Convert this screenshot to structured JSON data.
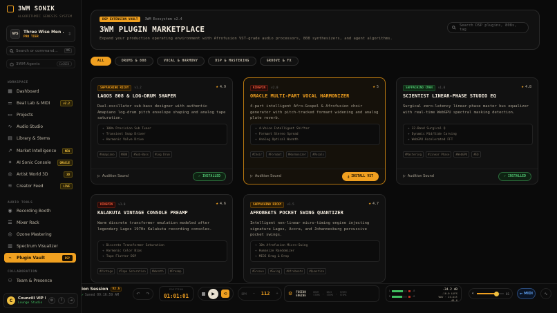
{
  "brand": {
    "title": "3WM SONIK",
    "subtitle": "ALGORITHMIC GENESIS SYSTEM"
  },
  "workspace": {
    "initials": "WS",
    "name": "Three Wise Men ...",
    "tier": "PRO TIER"
  },
  "search": {
    "placeholder": "Search or command...",
    "shortcut": "⌘K"
  },
  "agents": {
    "label": "3WM Agents",
    "state": "CLOSED"
  },
  "sections": {
    "workspace": "WORKSPACE",
    "audio_tools": "AUDIO TOOLS",
    "collaboration": "COLLABORATION"
  },
  "nav": [
    {
      "label": "Dashboard",
      "icon": "grid-icon"
    },
    {
      "label": "Beat Lab & MIDI",
      "icon": "sliders-icon",
      "badge": "v2.2"
    },
    {
      "label": "Projects",
      "icon": "folder-icon"
    },
    {
      "label": "Audio Studio",
      "icon": "waveform-icon"
    },
    {
      "label": "Library & Stems",
      "icon": "library-icon"
    },
    {
      "label": "Market Intelligence",
      "icon": "chart-icon",
      "badge": "NEW"
    },
    {
      "label": "AI Sonic Console",
      "icon": "sparkle-icon",
      "badge": "ORACLE"
    },
    {
      "label": "Artist World 3D",
      "icon": "globe-icon",
      "badge": "3D"
    },
    {
      "label": "Creator Feed",
      "icon": "feed-icon",
      "badge": "LIVE"
    }
  ],
  "audio_nav": [
    {
      "label": "Recording Booth",
      "icon": "mic-icon"
    },
    {
      "label": "Mixer Rack",
      "icon": "mixer-icon"
    },
    {
      "label": "Ozone Mastering",
      "icon": "target-icon"
    },
    {
      "label": "Spectrum Visualizer",
      "icon": "spectrum-icon"
    },
    {
      "label": "Plugin Vault",
      "icon": "plug-icon",
      "badge": "DSP"
    }
  ],
  "collab_nav": [
    {
      "label": "Team & Presence",
      "icon": "team-icon"
    }
  ],
  "user": {
    "initial": "C",
    "name": "Councill VIP P...",
    "status": "Lounge Studio"
  },
  "hero": {
    "kicker": "DSP EXTENSION VAULT",
    "ecosystem": "3WM Ecosystem v2.4",
    "title": "3WM PLUGIN MARKETPLACE",
    "desc": "Expand your production operating environment with Afrofusion VST-grade audio processors, 808 synthesizers, and agent algorithms.",
    "search_placeholder": "Search DSP plugins, 808s, tag"
  },
  "filters": [
    "ALL",
    "DRUMS & 808",
    "VOCAL & HARMONY",
    "DSP & MASTERING",
    "GROOVE & FX"
  ],
  "cards": [
    {
      "vendor": "SAPPACHINO RICKY",
      "vendor_color": "amber",
      "version": "v1.2",
      "rating": "4.9",
      "title": "LAGOS 808 & LOG-DRUM SHAPER",
      "desc": "Dual-oscillator sub-bass designer with authentic Amapiano log-drum pitch envelope shaping and analog tape saturation.",
      "features": [
        "100% Precision Sub Tuner",
        "Transient Snap Driver",
        "Harmonic Valve Drive"
      ],
      "tags": [
        "#Amapiano",
        "#808",
        "#Sub-Bass",
        "#Log Drum"
      ],
      "audition": "Audition Sound",
      "action": "INSTALLED",
      "action_type": "installed"
    },
    {
      "vendor": "KINGPIN",
      "vendor_color": "red",
      "version": "v2.0",
      "rating": "5",
      "title": "ORACLE MULTI-PART VOCAL HARMONIZER",
      "desc": "4-part intelligent Afro-Gospel & Afrofusion choir generator with pitch-tracked formant widening and analog plate reverb.",
      "features": [
        "4-Voice Intelligent Shifter",
        "Formant Stereo Spread",
        "Analog Optical Warmth"
      ],
      "tags": [
        "#Choir",
        "#Formant",
        "#Harmonizer",
        "#Vocals"
      ],
      "audition": "Audition Sound",
      "action": "INSTALL VST",
      "action_type": "install",
      "featured": true
    },
    {
      "vendor": "SAPPACHINO CMAN",
      "vendor_color": "green",
      "version": "v1.0",
      "rating": "4.8",
      "title": "SCIENTIST LINEAR-PHASE STUDIO EQ",
      "desc": "Surgical zero-latency linear-phase master bus equalizer with real-time WebGPU spectral masking detection.",
      "features": [
        "32-Band Surgical Q",
        "Dynamic Mid/Side Carving",
        "WebGPU Accelerated FFT"
      ],
      "tags": [
        "#Mastering",
        "#Linear Phase",
        "#WebGPU",
        "#EQ"
      ],
      "audition": "Audition Sound",
      "action": "INSTALLED",
      "action_type": "installed"
    },
    {
      "vendor": "KINGPIN",
      "vendor_color": "red",
      "version": "v1.0",
      "rating": "4.6",
      "title": "KALAKUTA VINTAGE CONSOLE PREAMP",
      "desc": "Warm discrete transformer emulation modeled after legendary Lagos 1970s Kalakuta recording consoles.",
      "features": [
        "Discrete Transformer Saturation",
        "Harmonic Color Bias",
        "Tape Flutter DSP"
      ],
      "tags": [
        "#Vintage",
        "#Tape Saturation",
        "#Warmth",
        "#Preamp"
      ]
    },
    {
      "vendor": "SAPPACHINO RICKY",
      "vendor_color": "amber",
      "version": "v1.5",
      "rating": "4.7",
      "title": "AFROBEATS POCKET SWING QUANTIZER",
      "desc": "Intelligent non-linear micro-timing engine injecting signature Lagos, Accra, and Johannesburg percussive pocket swings.",
      "features": [
        "10% Afrofusion Micro-Swing",
        "Humanize Randomizer",
        "MIDI Drag & Drop"
      ],
      "tags": [
        "#Groove",
        "#Swing",
        "#Afrobeats",
        "#Quantize"
      ]
    }
  ],
  "transport": {
    "session": "ion Session",
    "session_ver": "V2.5",
    "saved": "Saved 09:16:59 AM",
    "time_label": "POSITION",
    "time": "01:01:01",
    "bpm_label": "BPM",
    "bpm": "112",
    "engine_title_1": "FUSION",
    "engine_title_2": "ENGINE",
    "steps": [
      [
        "DRUM",
        "STEMS"
      ],
      [
        "BASS",
        "STEMS"
      ],
      [
        "SYNTH",
        "STEMS"
      ]
    ],
    "meters": [
      {
        "label": "L",
        "level": 0.72,
        "value": "-8"
      },
      {
        "label": "R",
        "level": 0.68,
        "value": "-8"
      }
    ],
    "readout_1": "-34.2 dB",
    "readout_2": "-10.0 LUFS",
    "readout_3": "WAV · 24-bit",
    "readout_4": "48.0",
    "volume": 0.72,
    "volume_value": "81",
    "midi_label": "MIDI"
  }
}
